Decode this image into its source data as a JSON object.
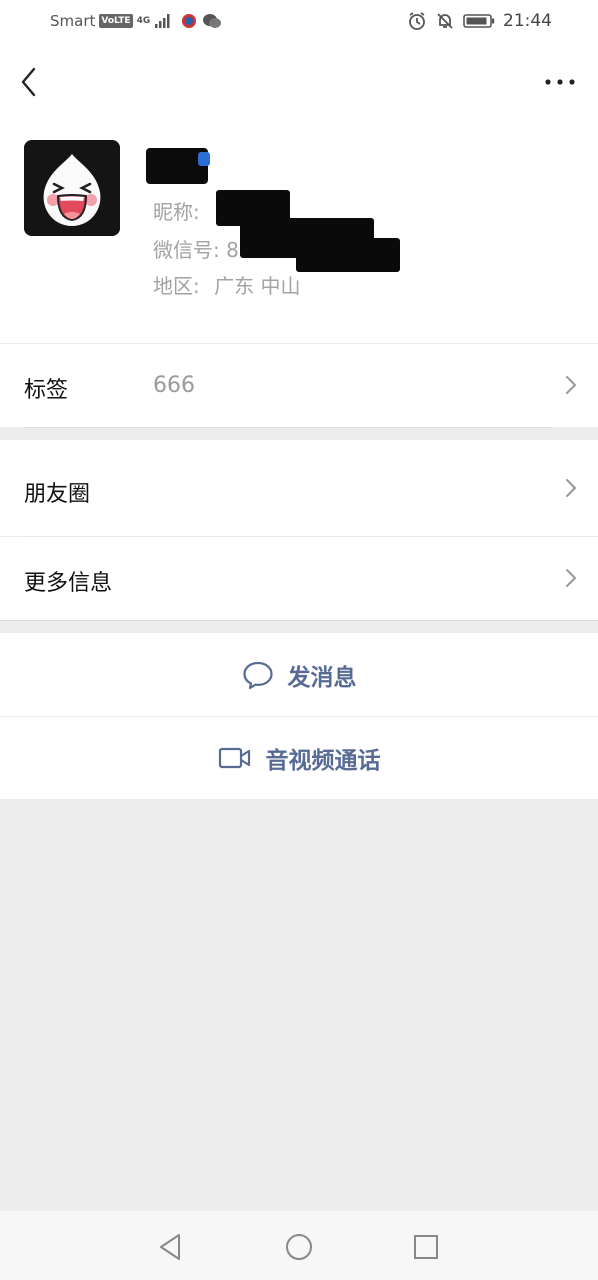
{
  "status_bar": {
    "carrier": "Smart",
    "volte": "VoLTE",
    "network": "4G",
    "time": "21:44"
  },
  "nav": {
    "back_icon": "back-chevron-icon",
    "more_icon": "more-dots-icon"
  },
  "profile": {
    "nickname_label": "昵称:",
    "wechat_id_label": "微信号:",
    "wechat_id_partial": "8",
    "region_label": "地区:",
    "region_value": "广东  中山"
  },
  "tags_row": {
    "label": "标签",
    "value": "666"
  },
  "moments_row": {
    "label": "朋友圈"
  },
  "more_info_row": {
    "label": "更多信息"
  },
  "actions": {
    "send_message": "发消息",
    "video_call": "音视频通话"
  },
  "colors": {
    "background": "#ededed",
    "link_blue": "#576b95",
    "secondary_text": "#a2a2a2"
  }
}
